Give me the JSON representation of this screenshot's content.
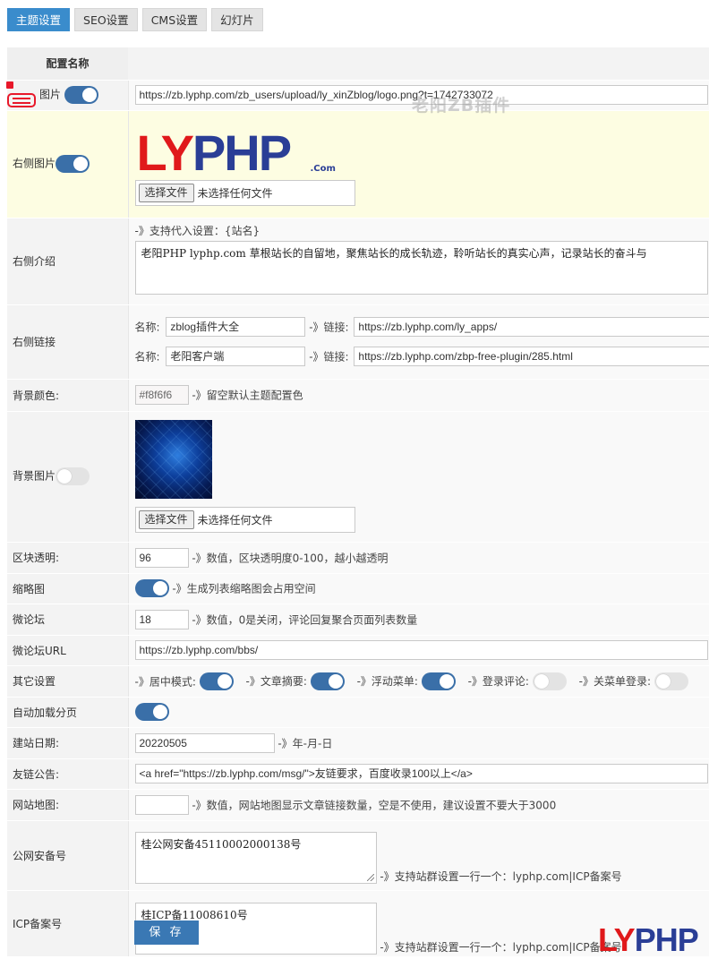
{
  "tabs": [
    "主题设置",
    "SEO设置",
    "CMS设置",
    "幻灯片"
  ],
  "header": {
    "col_name": "配置名称"
  },
  "logo": {
    "label": "图片",
    "url": "https://zb.lyphp.com/zb_users/upload/ly_xinZblog/logo.png?t=1742733072"
  },
  "right_image": {
    "label": "右侧图片",
    "logo_text_1": "LY",
    "logo_text_2": "PHP",
    "logo_suffix": ".Com",
    "file_button": "选择文件",
    "file_status": "未选择任何文件"
  },
  "right_intro": {
    "label": "右侧介绍",
    "hint": "-》支持代入设置：{站名}",
    "text": "老阳PHP lyphp.com 草根站长的自留地，聚焦站长的成长轨迹，聆听站长的真实心声，记录站长的奋斗与"
  },
  "right_links": {
    "label": "右侧链接",
    "rows": [
      {
        "name_label": "名称:",
        "name": "zblog插件大全",
        "link_label": "-》链接:",
        "url": "https://zb.lyphp.com/ly_apps/"
      },
      {
        "name_label": "名称:",
        "name": "老阳客户端",
        "link_label": "-》链接:",
        "url": "https://zb.lyphp.com/zbp-free-plugin/285.html"
      }
    ]
  },
  "bg_color": {
    "label": "背景颜色:",
    "value": "#f8f6f6",
    "note": "-》留空默认主题配置色"
  },
  "bg_image": {
    "label": "背景图片",
    "file_button": "选择文件",
    "file_status": "未选择任何文件"
  },
  "block_alpha": {
    "label": "区块透明:",
    "value": "96",
    "note": "-》数值，区块透明度0-100，越小越透明"
  },
  "thumbnail": {
    "label": "缩略图",
    "note": "-》生成列表缩略图会占用空间"
  },
  "micro_forum": {
    "label": "微论坛",
    "value": "18",
    "note": "-》数值，0是关闭，评论回复聚合页面列表数量"
  },
  "micro_forum_url": {
    "label": "微论坛URL",
    "value": "https://zb.lyphp.com/bbs/"
  },
  "other": {
    "label": "其它设置",
    "items": [
      "-》居中模式:",
      "-》文章摘要:",
      "-》浮动菜单:",
      "-》登录评论:",
      "-》关菜单登录:"
    ]
  },
  "auto_paging": {
    "label": "自动加载分页"
  },
  "build_date": {
    "label": "建站日期:",
    "value": "20220505",
    "note": "-》年-月-日"
  },
  "friend_notice": {
    "label": "友链公告:",
    "value": "<a href=\"https://zb.lyphp.com/msg/\">友链要求，百度收录100以上</a>"
  },
  "sitemap": {
    "label": "网站地图:",
    "value": "",
    "note": "-》数值，网站地图显示文章链接数量，空是不使用，建议设置不要大于3000"
  },
  "police": {
    "label": "公网安备号",
    "value": "桂公网安备45110002000138号",
    "note": "-》支持站群设置一行一个：lyphp.com|ICP备案号"
  },
  "icp": {
    "label": "ICP备案号",
    "value": "桂ICP备11008610号",
    "note": "-》支持站群设置一行一个：lyphp.com|ICP备案号"
  },
  "save_label": "保 存",
  "watermark": {
    "text": "老阳ZB插件",
    "logo_1": "LY",
    "logo_2": "PHP"
  },
  "colors": {
    "accent": "#3a8ccc",
    "switch_on": "#3a6fa8",
    "highlight_row": "#fdfde2",
    "logo_red": "#e0191b",
    "logo_blue": "#2a3e96"
  }
}
